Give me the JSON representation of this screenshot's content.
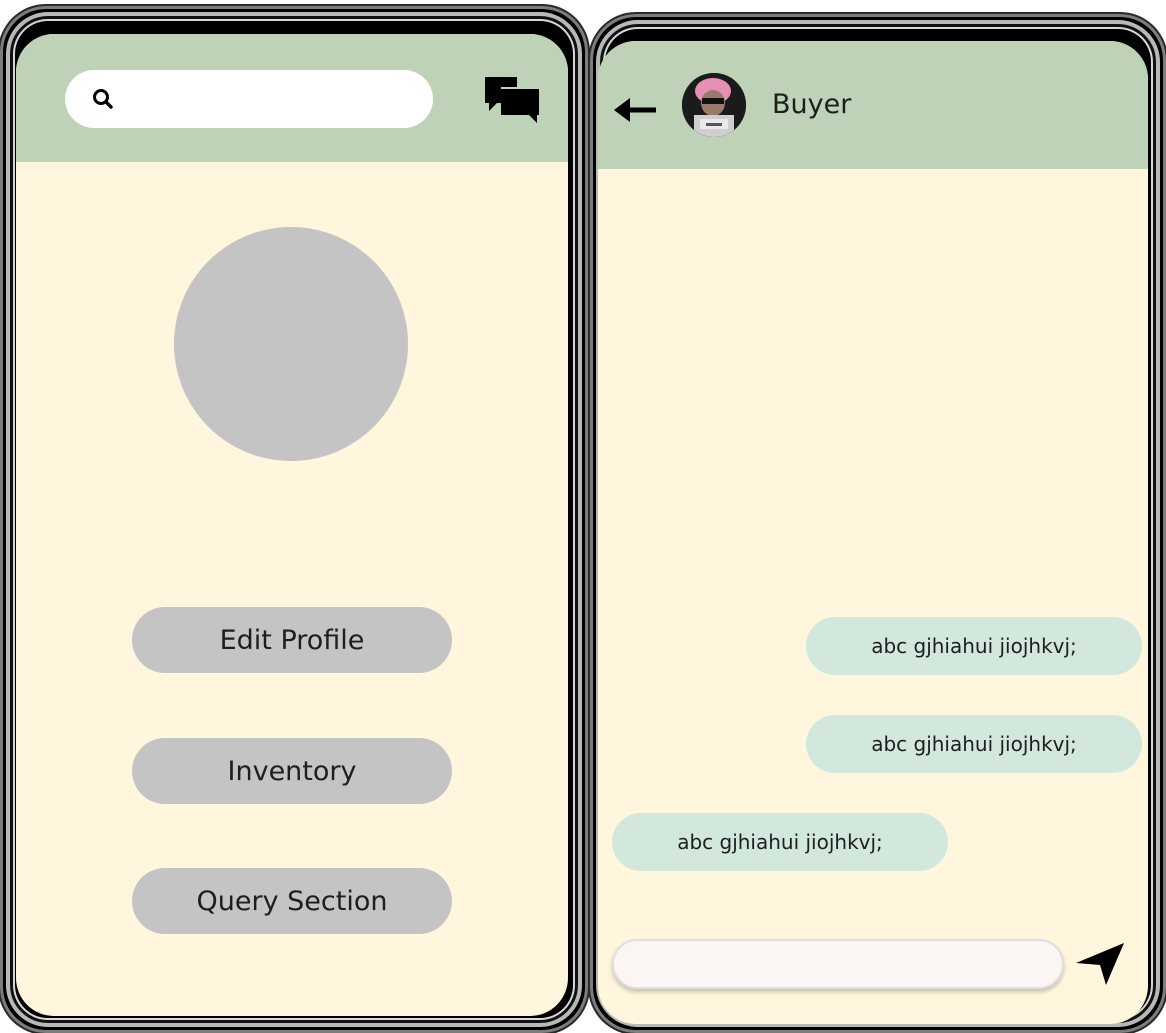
{
  "left_screen": {
    "search": {
      "value": "",
      "placeholder": ""
    },
    "buttons": {
      "edit_profile": "Edit Profile",
      "inventory": "Inventory",
      "query_section": "Query Section"
    }
  },
  "right_screen": {
    "contact_name": "Buyer",
    "messages": [
      {
        "direction": "outgoing",
        "text": "abc gjhiahui jiojhkvj;"
      },
      {
        "direction": "outgoing",
        "text": "abc gjhiahui jiojhkvj;"
      },
      {
        "direction": "incoming",
        "text": "abc gjhiahui jiojhkvj;"
      }
    ],
    "message_input": {
      "value": "",
      "placeholder": ""
    }
  },
  "icons": {
    "search": "search-icon",
    "chat": "chat-bubbles-icon",
    "back": "back-arrow-icon",
    "send": "send-icon"
  },
  "colors": {
    "app_bar": "#bed2b7",
    "screen_background": "#fff6dd",
    "button_background": "#c4c4c4",
    "profile_placeholder": "#c4c4c4",
    "message_bubble": "#d2e8dc",
    "message_input_background": "#fbf6f3"
  }
}
